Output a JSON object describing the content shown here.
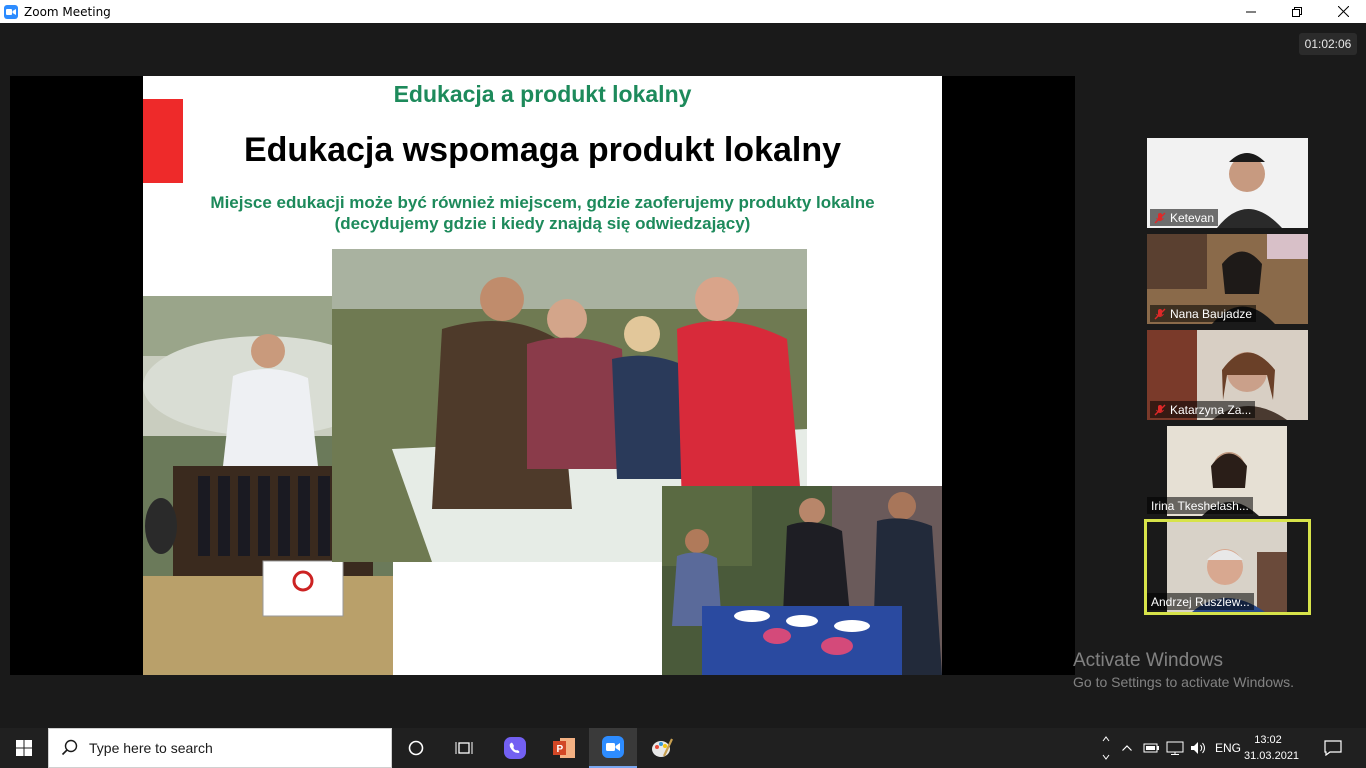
{
  "window": {
    "title": "Zoom Meeting"
  },
  "meeting": {
    "timer": "01:02:06"
  },
  "slide": {
    "header": "Edukacja a produkt lokalny",
    "headline": "Edukacja wspomaga produkt lokalny",
    "subtitle_line1": "Miejsce edukacji może być również miejscem, gdzie zaoferujemy produkty lokalne",
    "subtitle_line2": "(decydujemy gdzie i kiedy znajdą się odwiedzający)"
  },
  "participants": [
    {
      "name": "Ketevan",
      "muted": true
    },
    {
      "name": "Nana Baujadze",
      "muted": true
    },
    {
      "name": "Katarzyna Za...",
      "muted": true
    },
    {
      "name": "Irina Tkeshelash...",
      "muted": false
    },
    {
      "name": "Andrzej Ruszlew...",
      "muted": false,
      "active_speaker": true
    }
  ],
  "watermark": {
    "line1": "Activate Windows",
    "line2": "Go to Settings to activate Windows."
  },
  "taskbar": {
    "search_placeholder": "Type here to search",
    "language": "ENG",
    "time": "13:02",
    "date": "31.03.2021",
    "apps": [
      "cortana-icon",
      "task-view-icon",
      "viber-icon",
      "powerpoint-icon",
      "zoom-icon",
      "paint-icon"
    ]
  },
  "colors": {
    "slide_green": "#1d8a5b",
    "slide_red": "#ee2a2a",
    "speaker_highlight": "#d7e34a",
    "zoom_blue": "#2d8cff"
  }
}
